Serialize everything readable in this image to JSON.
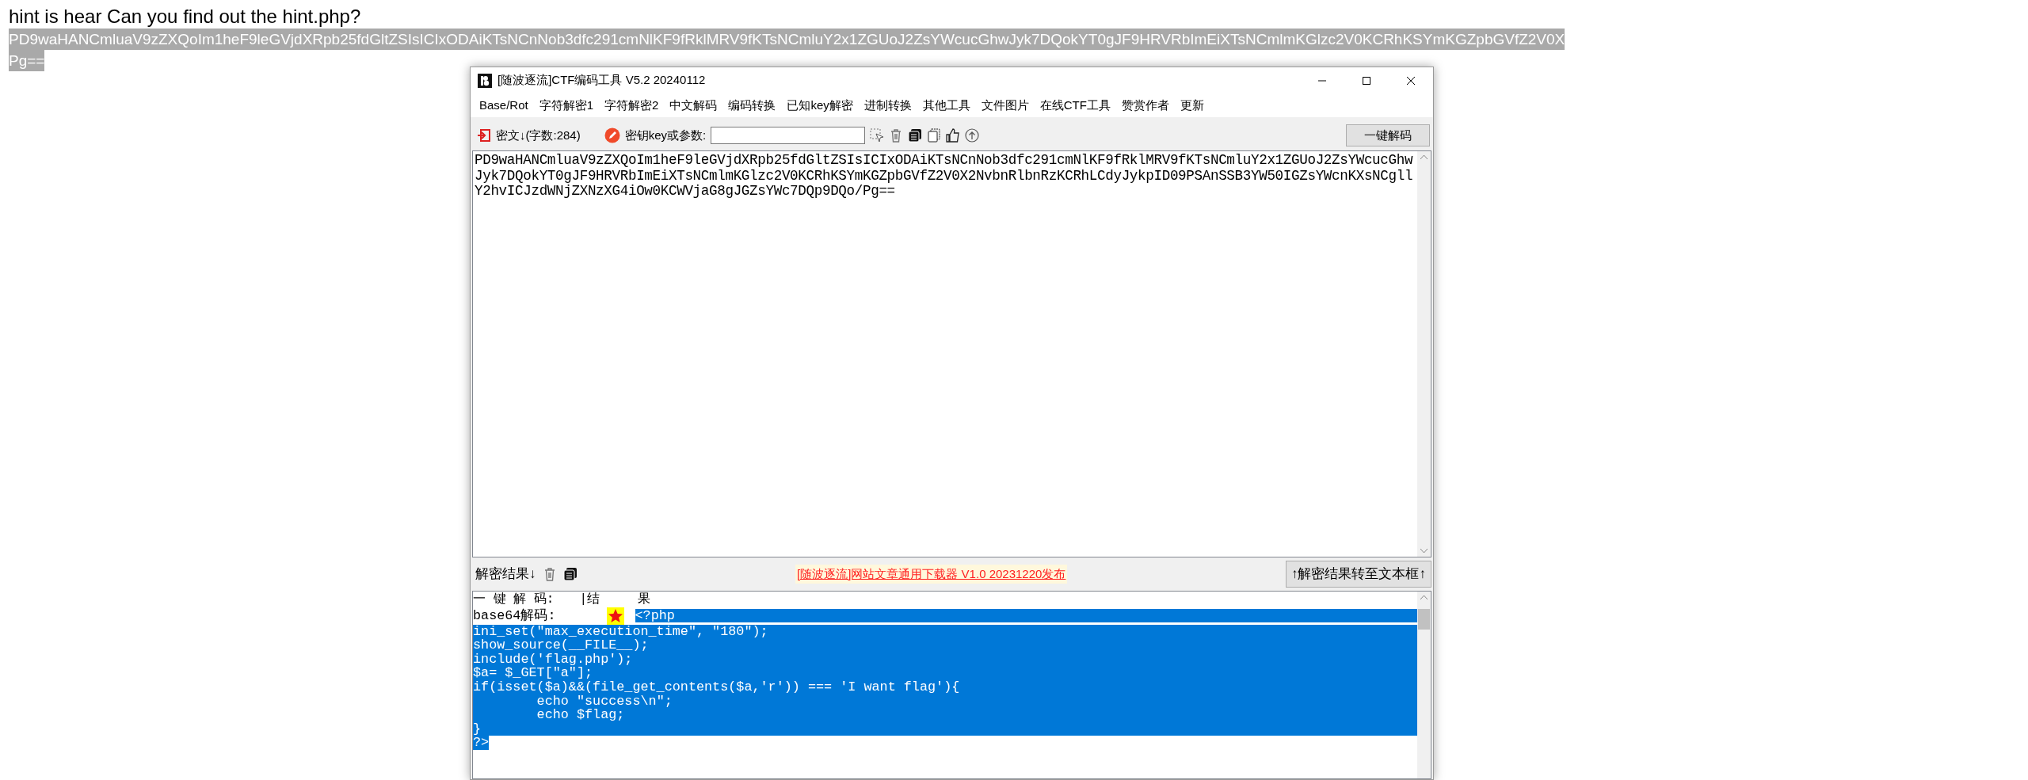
{
  "page": {
    "heading": "hint is hear Can you find out the hint.php?",
    "selection": {
      "selected": true,
      "lines": [
        "PD9waHANCmluaV9zZXQoIm1heF9leGVjdXRpb25fdGltZSIsICIxODAiKTsNCnNob3dfc291cmNlKF9fRklMRV9fKTsNCmluY2x1ZGUoJ2ZsYWcucGhwJyk7DQokYT0gJF9HRVRbImEiXTsNCmlmKGlzc2V0KCRhKSYmKGZpbGVfZ2V0X",
        "Pg=="
      ]
    }
  },
  "window": {
    "title": "[随波逐流]CTF编码工具 V5.2 20240112"
  },
  "menu": [
    "Base/Rot",
    "字符解密1",
    "字符解密2",
    "中文解码",
    "编码转换",
    "已知key解密",
    "进制转换",
    "其他工具",
    "文件图片",
    "在线CTF工具",
    "赞赏作者",
    "更新"
  ],
  "toolbar": {
    "cipher_label": "密文↓(字数:284)",
    "key_label": "密钥key或参数:",
    "decode_button": "一键解码"
  },
  "ciphertext": "PD9waHANCmluaV9zZXQoIm1heF9leGVjdXRpb25fdGltZSIsICIxODAiKTsNCnNob3dfc291cmNlKF9fRklMRV9fKTsNCmluY2x1ZGUoJ2ZsYWcucGhwJyk7DQokYT0gJF9HRVRbImEiXTsNCmlmKGlzc2V0KCRhKSYmKGZpbGVfZ2V0X2NvbnRlbnRzKCRhLCdyJykpID09PSAnSSB3YW50IGZsYWcnKXsNCgllY2hvICJzdWNjZXNzXG4iOw0KCWVjaG8gJGZsYWc7DQp9DQo/Pg==",
  "result_bar": {
    "label": "解密结果↓",
    "promo_link": "[随波逐流]网站文章通用下载器 V1.0 20231220发布",
    "transfer_button": "↑解密结果转至文本框↑"
  },
  "result": {
    "header": [
      "一 键 解 码:",
      "|结     果"
    ],
    "decoder": "base64解码:",
    "decoded": {
      "selected": true,
      "lines": [
        "<?php",
        "ini_set(\"max_execution_time\", \"180\");",
        "show_source(__FILE__);",
        "include('flag.php');",
        "$a= $_GET[\"a\"];",
        "if(isset($a)&&(file_get_contents($a,'r')) === 'I want flag'){",
        "\techo \"success\\n\";",
        "\techo $flag;",
        "}",
        "?>"
      ]
    }
  }
}
